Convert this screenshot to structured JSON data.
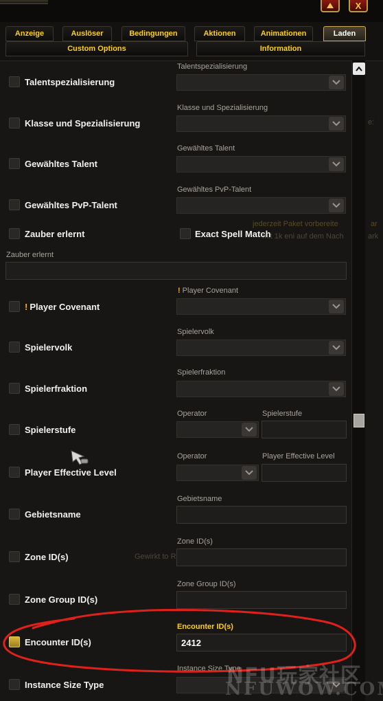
{
  "tabs_row1": [
    {
      "label": "Anzeige",
      "active": false
    },
    {
      "label": "Auslöser",
      "active": false
    },
    {
      "label": "Bedingungen",
      "active": false
    },
    {
      "label": "Aktionen",
      "active": false
    },
    {
      "label": "Animationen",
      "active": false
    },
    {
      "label": "Laden",
      "active": true
    }
  ],
  "tabs_row2": [
    {
      "label": "Custom Options",
      "active": false
    },
    {
      "label": "Information",
      "active": false
    }
  ],
  "window_buttons": {
    "up_icon": "triangle-up-icon",
    "close_icon": "close-icon",
    "close_glyph": "X"
  },
  "rows": {
    "talent_spec": {
      "label": "Talentspezialisierung",
      "field_label": "Talentspezialisierung",
      "checked": false
    },
    "class_spec": {
      "label": "Klasse und Spezialisierung",
      "field_label": "Klasse und Spezialisierung",
      "checked": false
    },
    "chosen_talent": {
      "label": "Gewähltes Talent",
      "field_label": "Gewähltes Talent",
      "checked": false
    },
    "pvp_talent": {
      "label": "Gewähltes PvP-Talent",
      "field_label": "Gewähltes PvP-Talent",
      "checked": false
    },
    "spell_learned": {
      "label": "Zauber erlernt",
      "checked": false,
      "exact_label": "Exact Spell Match",
      "exact_checked": false,
      "input_label": "Zauber erlernt",
      "input_value": ""
    },
    "player_covenant": {
      "excl": "!",
      "label": "Player Covenant",
      "field_excl": "!",
      "field_label": "Player Covenant",
      "checked": false
    },
    "race": {
      "label": "Spielervolk",
      "field_label": "Spielervolk",
      "checked": false
    },
    "faction": {
      "label": "Spielerfraktion",
      "field_label": "Spielerfraktion",
      "checked": false
    },
    "level": {
      "label": "Spielerstufe",
      "op_label": "Operator",
      "value_label": "Spielerstufe",
      "value": "",
      "checked": false
    },
    "effective_level": {
      "label": "Player Effective Level",
      "op_label": "Operator",
      "value_label": "Player Effective Level",
      "value": "",
      "checked": false
    },
    "zone_name": {
      "label": "Gebietsname",
      "field_label": "Gebietsname",
      "value": "",
      "checked": false
    },
    "zone_id": {
      "label": "Zone ID(s)",
      "field_label": "Zone ID(s)",
      "value": "",
      "checked": false
    },
    "zone_group": {
      "label": "Zone Group ID(s)",
      "field_label": "Zone Group ID(s)",
      "value": "",
      "checked": false
    },
    "encounter": {
      "label": "Encounter ID(s)",
      "field_label": "Encounter ID(s)",
      "value": "2412",
      "checked": true
    },
    "instance_size": {
      "label": "Instance Size Type",
      "field_label": "Instance Size Type",
      "checked": false
    }
  },
  "background_ghosts": {
    "g1": "Gewirkt to Re",
    "g2": "e:",
    "g3": "jederzeit Paket vorbereite",
    "g4": "mit 1k eni auf dem Nach",
    "g5": "ar",
    "g6": "ark"
  },
  "watermark": {
    "line1": "NFU玩家社区",
    "line2": "NFUWOW.COM"
  },
  "annotation": {
    "color": "#e0201a",
    "shape": "red hand-drawn ellipse"
  },
  "colors": {
    "accent_gold": "#ffd100",
    "checked_box": "#c9a930",
    "panel_bg": "#181614"
  }
}
